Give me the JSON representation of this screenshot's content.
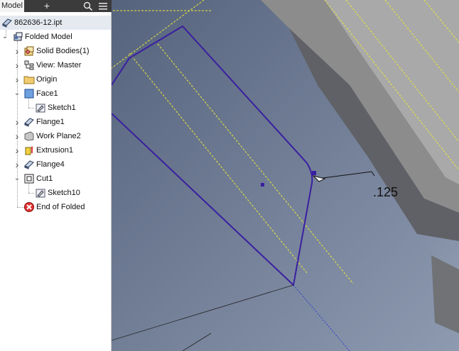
{
  "browser": {
    "tab_label": "Model",
    "add_tab_icon": "plus-icon",
    "search_icon": "search-icon",
    "menu_icon": "hamburger-menu-icon",
    "file_name": "862636-12.ipt",
    "root_label": "Folded Model",
    "items": [
      {
        "label": "Solid Bodies(1)",
        "icon": "solid-bodies-icon"
      },
      {
        "label": "View: Master",
        "icon": "view-icon"
      },
      {
        "label": "Origin",
        "icon": "folder-icon"
      },
      {
        "label": "Face1",
        "icon": "face-icon"
      },
      {
        "label": "Sketch1",
        "icon": "sketch-icon"
      },
      {
        "label": "Flange1",
        "icon": "flange-icon"
      },
      {
        "label": "Work Plane2",
        "icon": "work-plane-icon"
      },
      {
        "label": "Extrusion1",
        "icon": "extrusion-icon"
      },
      {
        "label": "Flange4",
        "icon": "flange-icon"
      },
      {
        "label": "Cut1",
        "icon": "cut-icon"
      },
      {
        "label": "Sketch10",
        "icon": "sketch-icon"
      },
      {
        "label": "End of Folded",
        "icon": "end-of-part-icon"
      }
    ]
  },
  "viewport": {
    "dimension_text": ".125"
  },
  "colors": {
    "sketch_line": "#3a1fa0",
    "construction_line": "#e8e83a",
    "tab_bar": "#3b3b3b",
    "end_of_part": "#e03030"
  }
}
